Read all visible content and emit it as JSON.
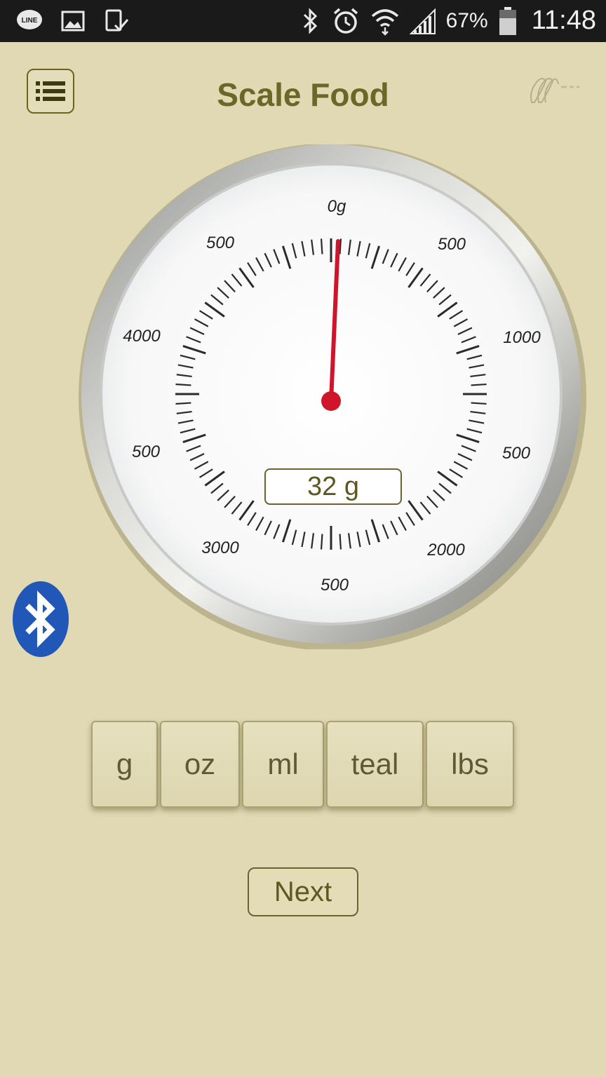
{
  "status_bar": {
    "icons_left": [
      "line-app-icon",
      "gallery-icon",
      "download-done-icon"
    ],
    "icons_right": [
      "bluetooth-icon",
      "alarm-icon",
      "wifi-icon",
      "signal-icon"
    ],
    "battery_percent": "67%",
    "time": "11:48"
  },
  "header": {
    "title": "Scale Food",
    "menu_icon": "list-icon",
    "logo_icon": "brand-logo-icon"
  },
  "scale": {
    "dial_labels": {
      "top": "0g",
      "top_right": "500",
      "right_upper": "1000",
      "right_lower": "500",
      "bottom_right": "2000",
      "bottom": "500",
      "bottom_left": "3000",
      "left_lower": "500",
      "left_upper": "4000",
      "top_left": "500"
    },
    "reading": "32 g",
    "needle_value_g": 32,
    "needle_color": "#d0142c"
  },
  "bluetooth": {
    "icon": "bluetooth-icon",
    "color": "#2158b8"
  },
  "units": [
    "g",
    "oz",
    "ml",
    "teal",
    "lbs"
  ],
  "next_label": "Next",
  "colors": {
    "background": "#e0d9b4",
    "title": "#6d6629",
    "accent_border": "#6a6330"
  }
}
